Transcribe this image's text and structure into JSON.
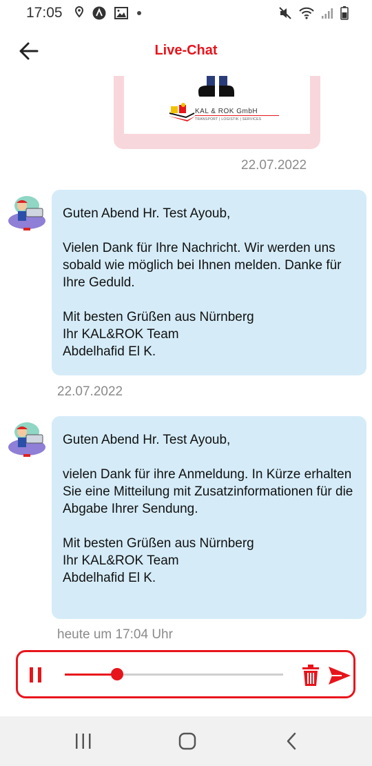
{
  "status_bar": {
    "time": "17:05"
  },
  "header": {
    "title": "Live-Chat"
  },
  "chat": {
    "image_message": {
      "logo_text": "KAL & ROK GmbH",
      "logo_subtext": "TRANSPORT | LOGISTIK | SERVICES",
      "timestamp": "22.07.2022"
    },
    "messages": [
      {
        "paragraphs": [
          "Guten Abend Hr. Test Ayoub,",
          "Vielen Dank für Ihre Nachricht. Wir werden uns sobald wie möglich bei Ihnen melden. Danke für Ihre Geduld.",
          "Mit besten Grüßen aus Nürnberg\nIhr KAL&ROK Team\nAbdelhafid El K."
        ],
        "timestamp": "22.07.2022"
      },
      {
        "paragraphs": [
          "Guten Abend Hr. Test Ayoub,",
          "vielen Dank für ihre Anmeldung. In Kürze erhalten Sie eine Mitteilung mit Zusatzinformationen für die Abgabe Ihrer Sendung.",
          "Mit besten Grüßen aus Nürnberg\nIhr KAL&ROK Team\nAbdelhafid El K."
        ],
        "timestamp": "heute um 17:04 Uhr"
      }
    ]
  },
  "audio_player": {
    "progress": 0.24
  },
  "colors": {
    "accent": "#e8141b",
    "bubble": "#d5ecf8",
    "image_frame": "#f8d7dc",
    "timestamp": "#8a8a8a"
  },
  "icons": {
    "back": "arrow-left-icon",
    "pause": "pause-icon",
    "trash": "trash-icon",
    "send": "send-icon",
    "nav_recents": "recents-icon",
    "nav_home": "home-icon",
    "nav_back": "chevron-left-icon"
  }
}
